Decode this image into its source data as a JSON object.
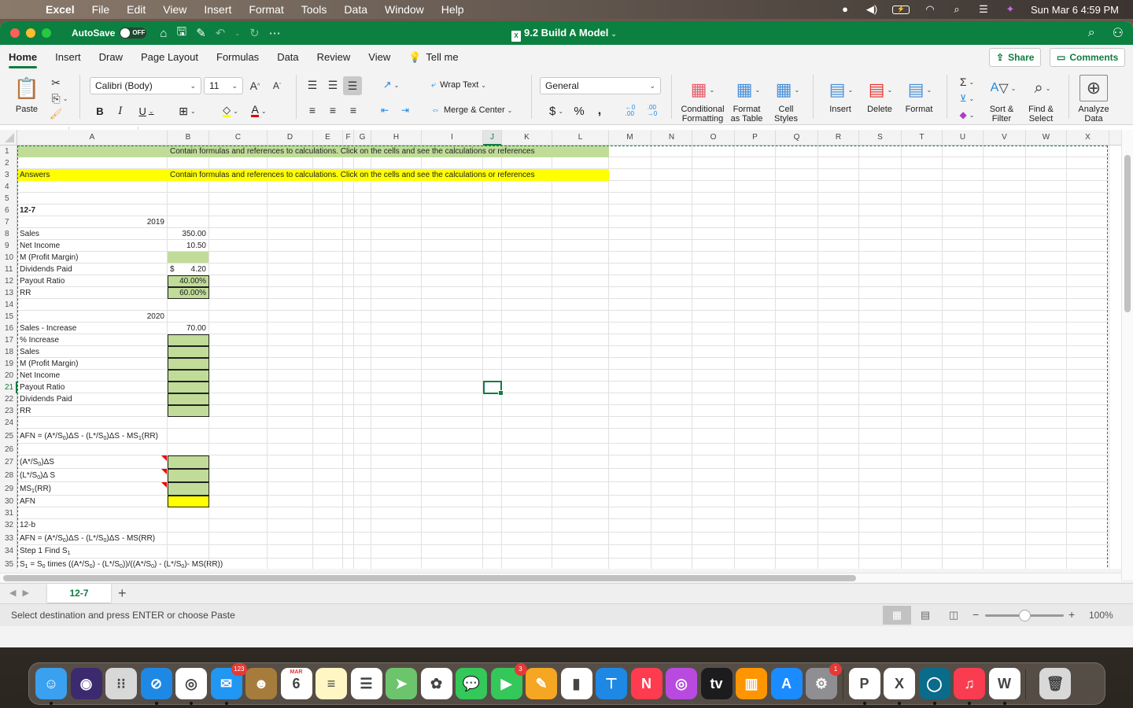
{
  "menubar": {
    "app": "Excel",
    "items": [
      "File",
      "Edit",
      "View",
      "Insert",
      "Format",
      "Tools",
      "Data",
      "Window",
      "Help"
    ],
    "datetime": "Sun Mar 6  4:59 PM",
    "status_icons": [
      "focus-icon",
      "volume-icon",
      "battery-icon",
      "wifi-icon",
      "spotlight-icon",
      "control-center-icon",
      "siri-icon"
    ]
  },
  "titlebar": {
    "autosave_label": "AutoSave",
    "autosave_state": "OFF",
    "doc_title": "9.2 Build A Model",
    "doc_badge": "X"
  },
  "ribbon_tabs": [
    "Home",
    "Insert",
    "Draw",
    "Page Layout",
    "Formulas",
    "Data",
    "Review",
    "View"
  ],
  "active_tab": "Home",
  "tell_me": "Tell me",
  "share_label": "Share",
  "comments_label": "Comments",
  "ribbon": {
    "paste": "Paste",
    "font_name": "Calibri (Body)",
    "font_size": "11",
    "wrap_text": "Wrap Text",
    "merge_center": "Merge & Center",
    "number_format": "General",
    "conditional_formatting": "Conditional\nFormatting",
    "cf_line1": "Conditional",
    "cf_line2": "Formatting",
    "fat_line1": "Format",
    "fat_line2": "as Table",
    "cs_line1": "Cell",
    "cs_line2": "Styles",
    "insert": "Insert",
    "delete": "Delete",
    "format": "Format",
    "sf_line1": "Sort &",
    "sf_line2": "Filter",
    "fs_line1": "Find &",
    "fs_line2": "Select",
    "ad_line1": "Analyze",
    "ad_line2": "Data",
    "colors": {
      "highlight": "#ffff00",
      "font_color": "#e00000"
    }
  },
  "formula_bar": {
    "name_box": "J21",
    "formula": ""
  },
  "columns": [
    "A",
    "B",
    "C",
    "D",
    "E",
    "F",
    "G",
    "H",
    "I",
    "J",
    "K",
    "L",
    "M",
    "N",
    "O",
    "P",
    "Q",
    "R",
    "S",
    "T",
    "U",
    "V",
    "W",
    "X"
  ],
  "selected_cell": "J21",
  "cells": {
    "r1_note": "Contain formulas and references to calculations.  Click on the cells and see the calculations or references",
    "r3_label": "Answers",
    "r3_note": "Contain formulas and references to calculations.  Click on the cells and see the calculations or references",
    "r6": "12-7",
    "r7_year": "2019",
    "r8": {
      "label": "Sales",
      "value": "350.00"
    },
    "r9": {
      "label": "Net Income",
      "value": "10.50"
    },
    "r10": {
      "label": "M (Profit Margin)",
      "value": ""
    },
    "r11": {
      "label": "Dividends Paid",
      "currency": "$",
      "value": "4.20"
    },
    "r12": {
      "label": "Payout Ratio",
      "value": "40.00%"
    },
    "r13": {
      "label": "RR",
      "value": "60.00%"
    },
    "r15_year": "2020",
    "r16": {
      "label": "Sales - Increase",
      "value": "70.00"
    },
    "r17": {
      "label": "% Increase",
      "value": ""
    },
    "r18": {
      "label": "Sales",
      "value": ""
    },
    "r19": {
      "label": "M (Profit Margin)",
      "value": ""
    },
    "r20": {
      "label": "Net Income",
      "value": ""
    },
    "r21": {
      "label": "Payout Ratio",
      "value": ""
    },
    "r22": {
      "label": "Dividends Paid",
      "value": ""
    },
    "r23": {
      "label": "RR",
      "value": ""
    },
    "r25_pre": "AFN = (A*/S",
    "r25_s1": "0",
    "r25_mid": ")ΔS - (L*/S",
    "r25_s2": "0",
    "r25_mid2": ")ΔS - MS",
    "r25_s3": "1",
    "r25_post": "(RR)",
    "r27_pre": " (A*/S",
    "r27_sub": "0",
    "r27_post": ")ΔS",
    "r28_pre": " (L*/S",
    "r28_sub": "0",
    "r28_post": ")Δ S",
    "r29_pre": "MS",
    "r29_sub": "1",
    "r29_post": "(RR)",
    "r30": "AFN",
    "r32": "12-b",
    "r33_pre": "AFN = (A*/S",
    "r33_s1": "0",
    "r33_mid": ")ΔS - (L*/S",
    "r33_s2": "0",
    "r33_post": ")ΔS - MS(RR)",
    "r34_pre": "Step 1 Find S",
    "r34_sub": "1",
    "r35_a": "S",
    "r35_s1": "1",
    "r35_b": " = S",
    "r35_s2": "0",
    "r35_c": " times ((A*/S",
    "r35_s3": "0",
    "r35_d": ") - (L*/S",
    "r35_s4": "0",
    "r35_e": "))/((A*/S",
    "r35_s5": "0",
    "r35_f": ") - (L*/S",
    "r35_s6": "0",
    "r35_g": ")- MS(RR))"
  },
  "sheet_tabs": [
    "12-7"
  ],
  "active_sheet": "12-7",
  "status": {
    "message": "Select destination and press ENTER or choose Paste",
    "zoom": "100%",
    "zoom_value": 100
  },
  "dock": {
    "apps": [
      {
        "name": "Finder",
        "icon": "finder-icon",
        "color": "#3aa0f0",
        "glyph": "☺",
        "running": true
      },
      {
        "name": "Siri",
        "icon": "siri-icon",
        "color": "#3b2a6e",
        "glyph": "◉",
        "running": false
      },
      {
        "name": "Launchpad",
        "icon": "launchpad-icon",
        "color": "#d8d8d8",
        "glyph": "⁝⁝",
        "running": false
      },
      {
        "name": "Safari",
        "icon": "safari-icon",
        "color": "#1e88e5",
        "glyph": "⊘",
        "running": true
      },
      {
        "name": "Chrome",
        "icon": "chrome-icon",
        "color": "#ffffff",
        "glyph": "◎",
        "running": true
      },
      {
        "name": "Mail",
        "icon": "mail-icon",
        "color": "#2196f3",
        "glyph": "✉",
        "badge": "123",
        "running": true
      },
      {
        "name": "Contacts",
        "icon": "contacts-icon",
        "color": "#a67c3d",
        "glyph": "☻",
        "running": false
      },
      {
        "name": "Calendar",
        "icon": "calendar-icon",
        "color": "#ffffff",
        "glyph": "6",
        "month": "MAR",
        "running": false
      },
      {
        "name": "Notes",
        "icon": "notes-icon",
        "color": "#fff6c4",
        "glyph": "≡",
        "running": false
      },
      {
        "name": "Reminders",
        "icon": "reminders-icon",
        "color": "#ffffff",
        "glyph": "☰",
        "running": false
      },
      {
        "name": "Maps",
        "icon": "maps-icon",
        "color": "#6cc56c",
        "glyph": "➤",
        "running": false
      },
      {
        "name": "Photos",
        "icon": "photos-icon",
        "color": "#ffffff",
        "glyph": "✿",
        "running": false
      },
      {
        "name": "Messages",
        "icon": "messages-icon",
        "color": "#34c759",
        "glyph": "💬",
        "running": false
      },
      {
        "name": "FaceTime",
        "icon": "facetime-icon",
        "color": "#34c759",
        "glyph": "▶",
        "badge": "3",
        "running": false
      },
      {
        "name": "Pages",
        "icon": "pages-icon",
        "color": "#f5a623",
        "glyph": "✎",
        "running": false
      },
      {
        "name": "Numbers",
        "icon": "numbers-icon",
        "color": "#ffffff",
        "glyph": "▮",
        "running": false
      },
      {
        "name": "Keynote",
        "icon": "keynote-icon",
        "color": "#1e88e5",
        "glyph": "⊤",
        "running": false
      },
      {
        "name": "News",
        "icon": "news-icon",
        "color": "#ff3b4f",
        "glyph": "N",
        "running": false
      },
      {
        "name": "Podcasts",
        "icon": "podcasts-icon",
        "color": "#b84ae0",
        "glyph": "◎",
        "running": false
      },
      {
        "name": "TV",
        "icon": "tv-icon",
        "color": "#1c1c1e",
        "glyph": "tv",
        "running": false
      },
      {
        "name": "Books",
        "icon": "books-icon",
        "color": "#ff9500",
        "glyph": "▥",
        "running": false
      },
      {
        "name": "App Store",
        "icon": "app-store-icon",
        "color": "#1a8cff",
        "glyph": "A",
        "running": false
      },
      {
        "name": "System Preferences",
        "icon": "system-preferences-icon",
        "color": "#8e8e93",
        "glyph": "⚙",
        "badge": "1",
        "running": false
      },
      {
        "name": "PowerPoint",
        "icon": "powerpoint-icon",
        "color": "#ffffff",
        "glyph": "P",
        "running": true
      },
      {
        "name": "Excel",
        "icon": "excel-icon",
        "color": "#ffffff",
        "glyph": "X",
        "running": true
      },
      {
        "name": "Webex",
        "icon": "webex-icon",
        "color": "#0a6b8a",
        "glyph": "◯",
        "running": true
      },
      {
        "name": "Music",
        "icon": "music-icon",
        "color": "#fa3c50",
        "glyph": "♫",
        "running": true
      },
      {
        "name": "Word",
        "icon": "word-icon",
        "color": "#ffffff",
        "glyph": "W",
        "running": true
      },
      {
        "name": "Trash",
        "icon": "trash-icon",
        "color": "#d8d8d8",
        "glyph": "🗑",
        "running": false
      }
    ]
  }
}
